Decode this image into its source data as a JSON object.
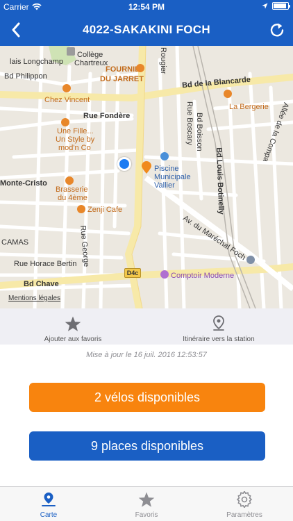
{
  "status_bar": {
    "carrier": "Carrier",
    "time": "12:54 PM",
    "battery_level": 0.9
  },
  "nav": {
    "title": "4022-SAKAKINI FOCH"
  },
  "map": {
    "labels": {
      "longchamp": "Bd Philippon",
      "lais": "lais Longchamp",
      "college1": "Collège",
      "college2": "Chartreux",
      "fournil1": "FOURNIL",
      "fournil2": "DU JARRET",
      "chez_vincent": "Chez Vincent",
      "rue_fondere": "Rue Fondère",
      "une_fille1": "Une Fille...",
      "une_fille2": "Un Style by",
      "une_fille3": "mod'n Co",
      "monte_cristo": "Monte-Cristo",
      "brasserie1": "Brasserie",
      "brasserie2": "du 4ème",
      "zenji": "Zenji Cafe",
      "camas": "CAMAS",
      "rue_george": "Rue George",
      "horace": "Rue Horace Bertin",
      "chave": "Bd Chave",
      "rougier": "Rougier",
      "blancarde": "Bd de la Blancarde",
      "bergerie": "La Bergerie",
      "boisson": "Bd Boisson",
      "boscary": "Rue Boscary",
      "bd_louis": "Bd Louis Botinelly",
      "piscine1": "Piscine",
      "piscine2": "Municipale",
      "piscine3": "Vallier",
      "foch": "Av. du Maréchal Foch",
      "comptoir": "Comptoir Moderne",
      "compa": "Allée de la Compa",
      "route": "D4c"
    },
    "legal": "Mentions légales"
  },
  "actions": {
    "favorite": "Ajouter aux favoris",
    "itinerary": "Itinéraire vers la station"
  },
  "updated": "Mise à jour le 16 juil. 2016 12:53:57",
  "bikes_label": "2 vélos disponibles",
  "places_label": "9 places disponibles",
  "tabs": [
    {
      "label": "Carte",
      "icon": "map-pin-icon"
    },
    {
      "label": "Favoris",
      "icon": "star-icon"
    },
    {
      "label": "Paramètres",
      "icon": "gear-icon"
    }
  ],
  "colors": {
    "brand_blue": "#1a5fc4",
    "orange": "#f8840e",
    "location": "#1d7cf2"
  }
}
